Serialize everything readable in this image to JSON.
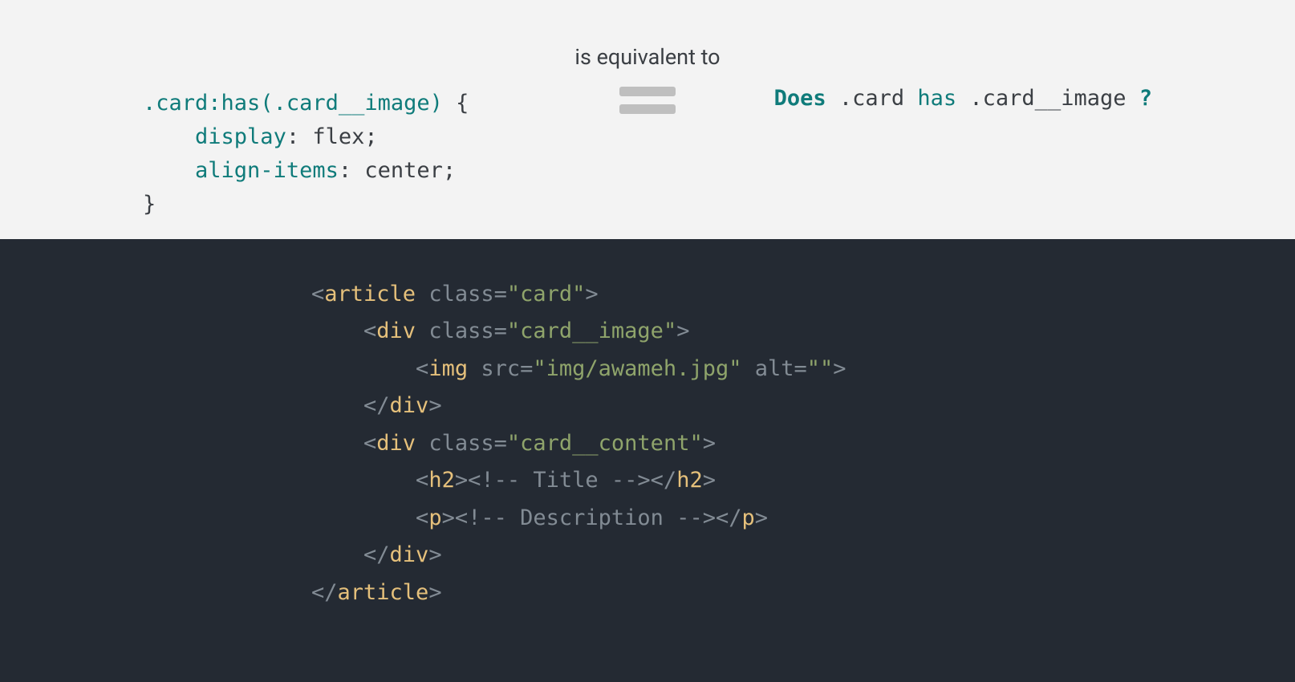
{
  "top": {
    "equiv_label": "is equivalent to",
    "css": {
      "selector_class": ".card",
      "selector_pseudo": ":has(",
      "selector_arg": ".card__image",
      "selector_close": ")",
      "open_brace": " {",
      "prop1_name": "display",
      "prop1_sep": ": ",
      "prop1_val": "flex;",
      "prop2_name": "align-items",
      "prop2_sep": ": ",
      "prop2_val": "center;",
      "close_brace": "}"
    },
    "question": {
      "does": "Does ",
      "sel1": ".card",
      "has": " has ",
      "sel2": ".card__image",
      "qm": " ?"
    }
  },
  "html": {
    "l1_open": "<",
    "l1_tag": "article",
    "l1_attr": " class=",
    "l1_str": "\"card\"",
    "l1_close": ">",
    "l2_open": "<",
    "l2_tag": "div",
    "l2_attr": " class=",
    "l2_str": "\"card__image\"",
    "l2_close": ">",
    "l3_open": "<",
    "l3_tag": "img",
    "l3_attr1": " src=",
    "l3_str1": "\"img/awameh.jpg\"",
    "l3_attr2": " alt=",
    "l3_str2": "\"\"",
    "l3_close": ">",
    "l4_open": "</",
    "l4_tag": "div",
    "l4_close": ">",
    "l5_open": "<",
    "l5_tag": "div",
    "l5_attr": " class=",
    "l5_str": "\"card__content\"",
    "l5_close": ">",
    "l6_open": "<",
    "l6_tag": "h2",
    "l6_mid": ">",
    "l6_comment": "<!-- Title -->",
    "l6_close_open": "</",
    "l6_c_tag": "h2",
    "l6_c_close": ">",
    "l7_open": "<",
    "l7_tag": "p",
    "l7_mid": ">",
    "l7_comment": "<!-- Description -->",
    "l7_close_open": "</",
    "l7_c_tag": "p",
    "l7_c_close": ">",
    "l8_open": "</",
    "l8_tag": "div",
    "l8_close": ">",
    "l9_open": "</",
    "l9_tag": "article",
    "l9_close": ">"
  }
}
